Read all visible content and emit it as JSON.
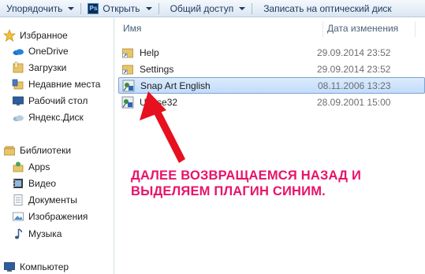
{
  "toolbar": {
    "organize_label": "Упорядочить",
    "open_label": "Открыть",
    "share_label": "Общий доступ",
    "burn_label": "Записать на оптический диск"
  },
  "sidebar": {
    "favorites": {
      "header": "Избранное",
      "items": [
        {
          "label": "OneDrive",
          "icon": "onedrive-icon"
        },
        {
          "label": "Загрузки",
          "icon": "downloads-folder-icon"
        },
        {
          "label": "Недавние места",
          "icon": "recent-places-icon"
        },
        {
          "label": "Рабочий стол",
          "icon": "desktop-icon"
        },
        {
          "label": "Яндекс.Диск",
          "icon": "yandex-disk-icon"
        }
      ]
    },
    "libraries": {
      "header": "Библиотеки",
      "items": [
        {
          "label": "Apps",
          "icon": "apps-icon"
        },
        {
          "label": "Видео",
          "icon": "video-icon"
        },
        {
          "label": "Документы",
          "icon": "documents-icon"
        },
        {
          "label": "Изображения",
          "icon": "pictures-icon"
        },
        {
          "label": "Музыка",
          "icon": "music-icon"
        }
      ]
    },
    "computer": {
      "header": "Компьютер"
    }
  },
  "columns": {
    "name": "Имя",
    "date": "Дата изменения"
  },
  "files": [
    {
      "name": "Help",
      "date": "29.09.2014 23:52",
      "icon": "shortcut-folder-icon",
      "selected": false
    },
    {
      "name": "Settings",
      "date": "29.09.2014 23:52",
      "icon": "shortcut-folder-icon",
      "selected": false
    },
    {
      "name": "Snap Art English",
      "date": "08.11.2006 13:23",
      "icon": "plugin-icon",
      "selected": true
    },
    {
      "name": "Unuse32",
      "date": "28.09.2001 15:00",
      "icon": "plugin-icon",
      "selected": false
    }
  ],
  "annotation": {
    "line1": "ДАЛЕЕ ВОЗВРАЩАЕМСЯ НАЗАД И",
    "line2": "ВЫДЕЛЯЕМ ПЛАГИН СИНИМ.",
    "color": "#e8136a"
  },
  "colors": {
    "selection": "#c1dcfc",
    "selection_border": "#7da2ce",
    "arrow": "#e6101e"
  }
}
